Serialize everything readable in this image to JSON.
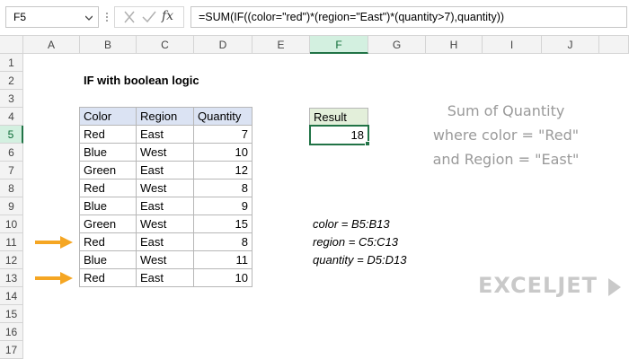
{
  "formula_bar": {
    "name_box": "F5",
    "formula": "=SUM(IF((color=\"red\")*(region=\"East\")*(quantity>7),quantity))",
    "fx_label": "fx"
  },
  "columns": [
    "A",
    "B",
    "C",
    "D",
    "E",
    "F",
    "G",
    "H",
    "I",
    "J"
  ],
  "rows": [
    "1",
    "2",
    "3",
    "4",
    "5",
    "6",
    "7",
    "8",
    "9",
    "10",
    "11",
    "12",
    "13",
    "14",
    "15",
    "16",
    "17"
  ],
  "sheet": {
    "title": "IF with boolean logic",
    "table": {
      "headers": [
        "Color",
        "Region",
        "Quantity"
      ],
      "rows": [
        [
          "Red",
          "East",
          "7"
        ],
        [
          "Blue",
          "West",
          "10"
        ],
        [
          "Green",
          "East",
          "12"
        ],
        [
          "Red",
          "West",
          "8"
        ],
        [
          "Blue",
          "East",
          "9"
        ],
        [
          "Green",
          "West",
          "15"
        ],
        [
          "Red",
          "East",
          "8"
        ],
        [
          "Blue",
          "West",
          "11"
        ],
        [
          "Red",
          "East",
          "10"
        ]
      ]
    },
    "result": {
      "label": "Result",
      "value": "18"
    },
    "note": [
      "Sum of Quantity",
      "where color = \"Red\"",
      "and Region = \"East\""
    ],
    "named_ranges": [
      "color = B5:B13",
      "region = C5:C13",
      "quantity = D5:D13"
    ]
  },
  "colors": {
    "arrow": "#f5a623",
    "selection": "#217346",
    "header_fill": "#dbe3f3",
    "result_fill": "#e3efda"
  },
  "logo": "EXCELJET"
}
